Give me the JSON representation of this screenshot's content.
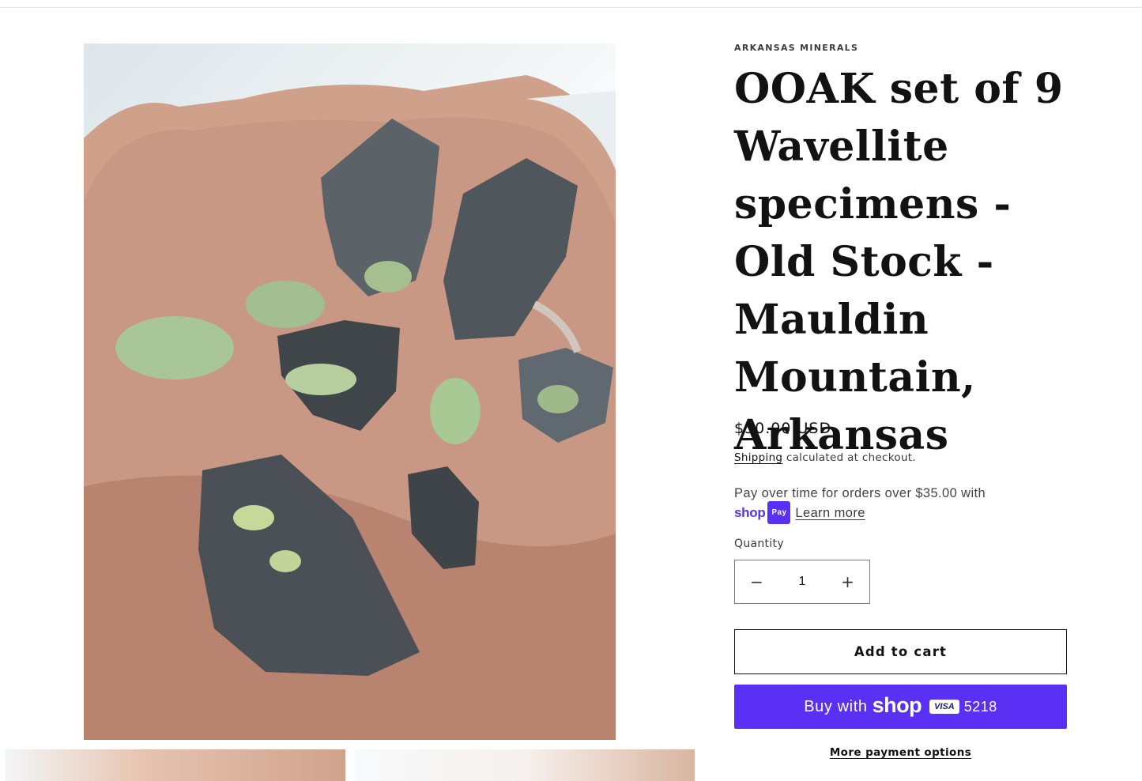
{
  "product": {
    "vendor": "ARKANSAS MINERALS",
    "title": "OOAK set of 9 Wavellite specimens - Old Stock - Mauldin Mountain, Arkansas",
    "price": "$30.00 USD",
    "shipping_link": "Shipping",
    "shipping_text": " calculated at checkout."
  },
  "installments": {
    "text": "Pay over time for orders over $35.00 with",
    "shop_word": "shop",
    "pay_pill": "Pay",
    "learn_more": "Learn more"
  },
  "quantity": {
    "label": "Quantity",
    "value": "1",
    "minus_symbol": "−",
    "plus_symbol": "+"
  },
  "buttons": {
    "add_to_cart": "Add to cart",
    "buy_with": "Buy with",
    "shop_word": "shop",
    "card_brand": "VISA",
    "card_last4": "5218",
    "more_payment_options": "More payment options"
  },
  "colors": {
    "shop_pay_purple": "#5a31f4",
    "text": "#121212"
  }
}
